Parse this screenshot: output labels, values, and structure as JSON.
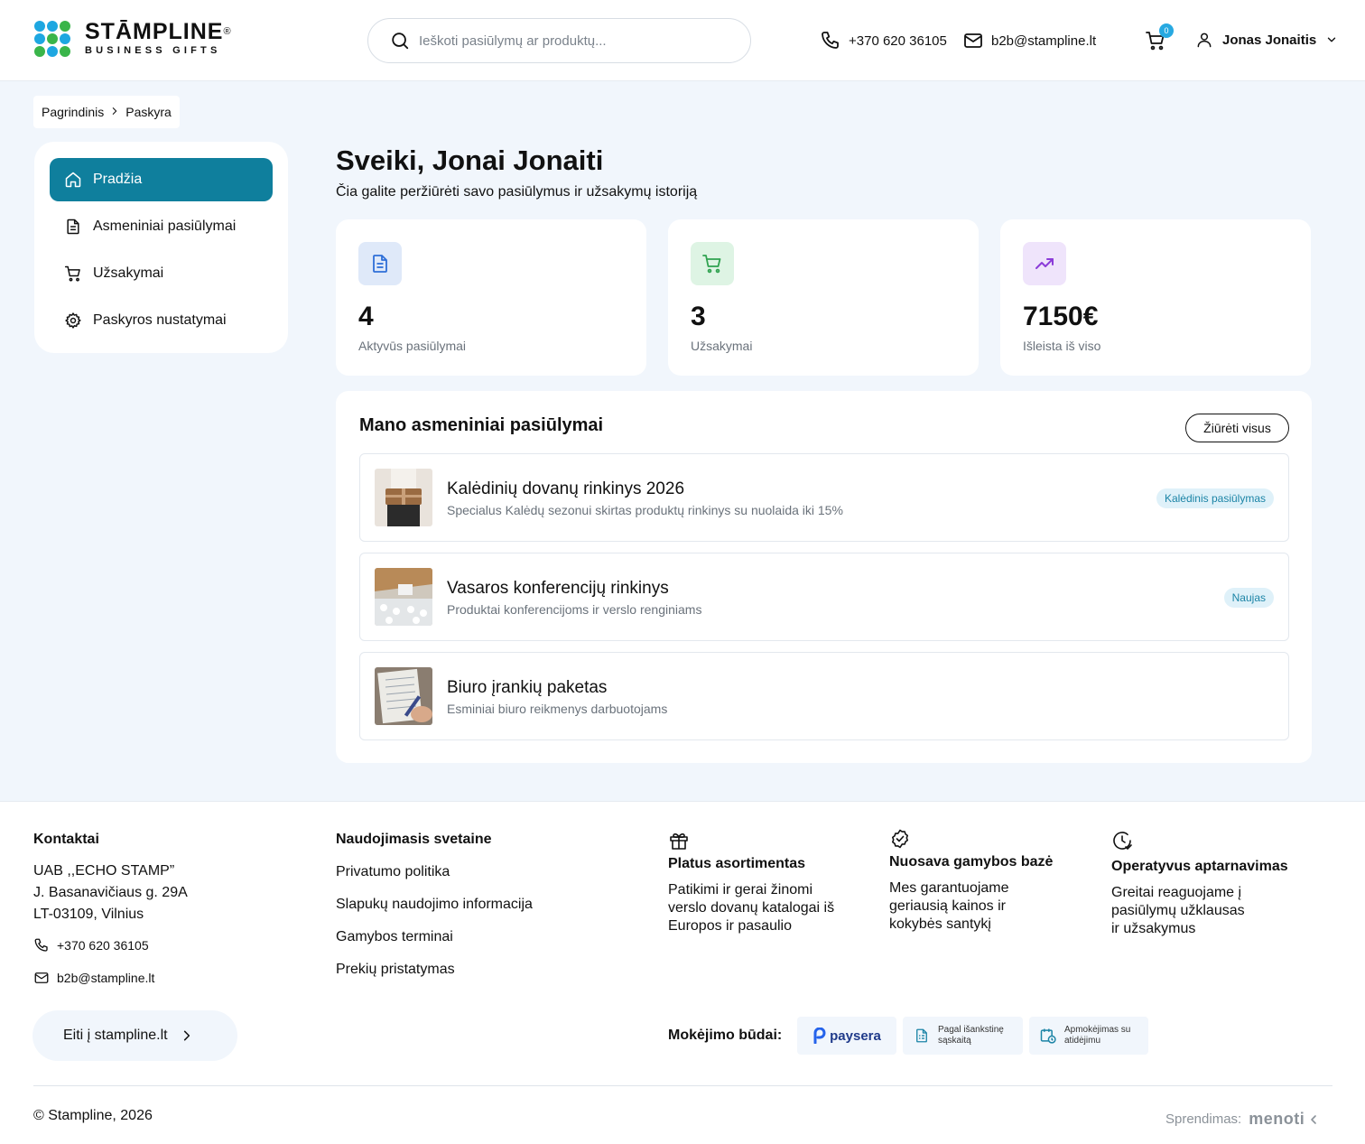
{
  "brand": {
    "name": "STĀMPLINE",
    "registered": "®",
    "tagline": "BUSINESS GIFTS",
    "dot_colors": [
      "#1ea7e1",
      "#1ea7e1",
      "#3ab54a",
      "#1ea7e1",
      "#3ab54a",
      "#1ea7e1",
      "#3ab54a",
      "#1ea7e1",
      "#3ab54a"
    ]
  },
  "header": {
    "search_placeholder": "Ieškoti pasiūlymų ar produktų...",
    "phone": "+370 620 36105",
    "email": "b2b@stampline.lt",
    "cart_count": "0",
    "user_name": "Jonas Jonaitis"
  },
  "breadcrumb": {
    "items": [
      "Pagrindinis",
      "Paskyra"
    ]
  },
  "sidebar": {
    "items": [
      {
        "label": "Pradžia",
        "icon": "home-icon",
        "active": true
      },
      {
        "label": "Asmeniniai pasiūlymai",
        "icon": "document-icon",
        "active": false
      },
      {
        "label": "Užsakymai",
        "icon": "cart-icon",
        "active": false
      },
      {
        "label": "Paskyros nustatymai",
        "icon": "gear-icon",
        "active": false
      }
    ]
  },
  "dashboard": {
    "title": "Sveiki, Jonai Jonaiti",
    "subtitle": "Čia galite peržiūrėti savo pasiūlymus ir užsakymų istoriją",
    "stats": [
      {
        "value": "4",
        "label": "Aktyvūs pasiūlymai",
        "icon": "document-icon",
        "color": "#2f6fd8",
        "bg": "#dfe9f9"
      },
      {
        "value": "3",
        "label": "Užsakymai",
        "icon": "cart-icon",
        "color": "#2fa24f",
        "bg": "#def4e4"
      },
      {
        "value": "7150€",
        "label": "Išleista iš viso",
        "icon": "trending-up-icon",
        "color": "#8b3cd8",
        "bg": "#efe4fb"
      }
    ]
  },
  "offers": {
    "title": "Mano asmeniniai pasiūlymai",
    "see_all": "Žiūrėti visus",
    "items": [
      {
        "name": "Kalėdinių dovanų rinkinys 2026",
        "desc": "Specialus Kalėdų sezonui skirtas produktų rinkinys su nuolaida iki 15%",
        "tag": "Kalėdinis pasiūlymas"
      },
      {
        "name": "Vasaros konferencijų rinkinys",
        "desc": "Produktai konferencijoms ir verslo renginiams",
        "tag": "Naujas"
      },
      {
        "name": "Biuro įrankių paketas",
        "desc": "Esminiai biuro reikmenys darbuotojams",
        "tag": ""
      }
    ]
  },
  "footer": {
    "contacts": {
      "title": "Kontaktai",
      "company": "UAB ,,ECHO STAMP”",
      "street": "J. Basanavičiaus g. 29A",
      "city": "LT-03109, Vilnius",
      "phone": "+370 620 36105",
      "email": "b2b@stampline.lt",
      "goto": "Eiti į stampline.lt"
    },
    "usage": {
      "title": "Naudojimasis svetaine",
      "links": [
        "Privatumo politika",
        "Slapukų naudojimo informacija",
        "Gamybos terminai",
        "Prekių pristatymas"
      ]
    },
    "features": [
      {
        "icon": "gift-icon",
        "title": "Platus asortimentas",
        "text": [
          "Patikimi ir gerai žinomi",
          "verslo dovanų katalogai iš",
          "Europos ir pasaulio"
        ]
      },
      {
        "icon": "badge-check-icon",
        "title": "Nuosava gamybos bazė",
        "text": [
          "Mes garantuojame",
          "geriausią kainos ir",
          "kokybės santykį"
        ]
      },
      {
        "icon": "clock-check-icon",
        "title": "Operatyvus aptarnavimas",
        "text": [
          "Greitai reaguojame į",
          "pasiūlymų užklausas",
          "ir užsakymus"
        ]
      }
    ],
    "payment": {
      "label": "Mokėjimo būdai:",
      "methods": [
        {
          "name": "paysera",
          "icon": "paysera-logo"
        },
        {
          "name": "Pagal išankstinę sąskaitą",
          "icon": "invoice-icon"
        },
        {
          "name": "Apmokėjimas su atidėjimu",
          "icon": "calendar-clock-icon"
        }
      ]
    },
    "copyright": "© Stampline, 2026",
    "solution_label": "Sprendimas:",
    "solution_brand": "menoti"
  }
}
